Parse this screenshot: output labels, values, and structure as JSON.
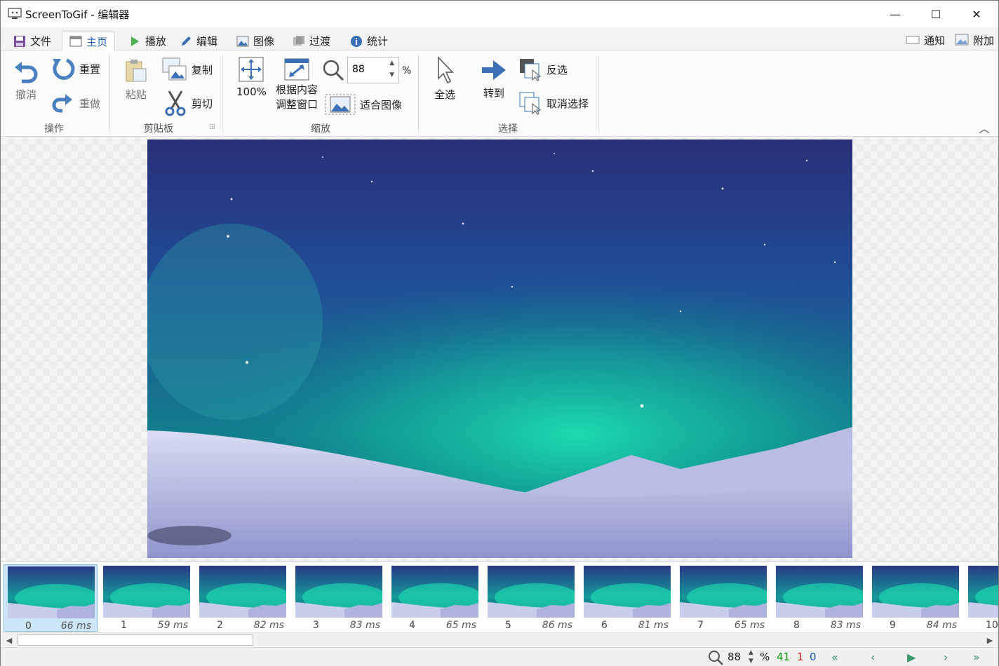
{
  "window": {
    "title": "ScreenToGif - 编辑器",
    "minimize": "—",
    "maximize": "☐",
    "close": "✕"
  },
  "tabs": [
    {
      "label": "文件",
      "icon": "save-icon"
    },
    {
      "label": "主页",
      "icon": "home-icon",
      "active": true
    },
    {
      "label": "播放",
      "icon": "play-icon"
    },
    {
      "label": "编辑",
      "icon": "pencil-icon"
    },
    {
      "label": "图像",
      "icon": "image-icon"
    },
    {
      "label": "过渡",
      "icon": "transition-icon"
    },
    {
      "label": "统计",
      "icon": "info-icon"
    }
  ],
  "right_tabs": {
    "notify": "通知",
    "extra": "附加"
  },
  "ribbon": {
    "actions": {
      "undo": "撤消",
      "reset": "重置",
      "redo": "重做",
      "group": "操作"
    },
    "clipboard": {
      "paste": "粘贴",
      "copy": "复制",
      "cut": "剪切",
      "group": "剪贴板"
    },
    "zoom": {
      "hundred": "100%",
      "fit_content_1": "根据内容",
      "fit_content_2": "调整窗口",
      "value": "88",
      "percent": "%",
      "fit_image": "适合图像",
      "group": "缩放"
    },
    "select": {
      "all": "全选",
      "goto": "转到",
      "invert": "反选",
      "deselect": "取消选择",
      "group": "选择"
    }
  },
  "frames": [
    {
      "index": "0",
      "delay": "66 ms"
    },
    {
      "index": "1",
      "delay": "59 ms"
    },
    {
      "index": "2",
      "delay": "82 ms"
    },
    {
      "index": "3",
      "delay": "83 ms"
    },
    {
      "index": "4",
      "delay": "65 ms"
    },
    {
      "index": "5",
      "delay": "86 ms"
    },
    {
      "index": "6",
      "delay": "81 ms"
    },
    {
      "index": "7",
      "delay": "65 ms"
    },
    {
      "index": "8",
      "delay": "83 ms"
    },
    {
      "index": "9",
      "delay": "84 ms"
    },
    {
      "index": "10",
      "delay": ""
    }
  ],
  "status": {
    "zoom": "88",
    "percent": "%",
    "total": "41",
    "selected": "1",
    "current": "0"
  },
  "colors": {
    "accent": "#1f5fb0",
    "status_green": "#119911",
    "status_red": "#cc2222",
    "status_blue": "#1155cc"
  }
}
